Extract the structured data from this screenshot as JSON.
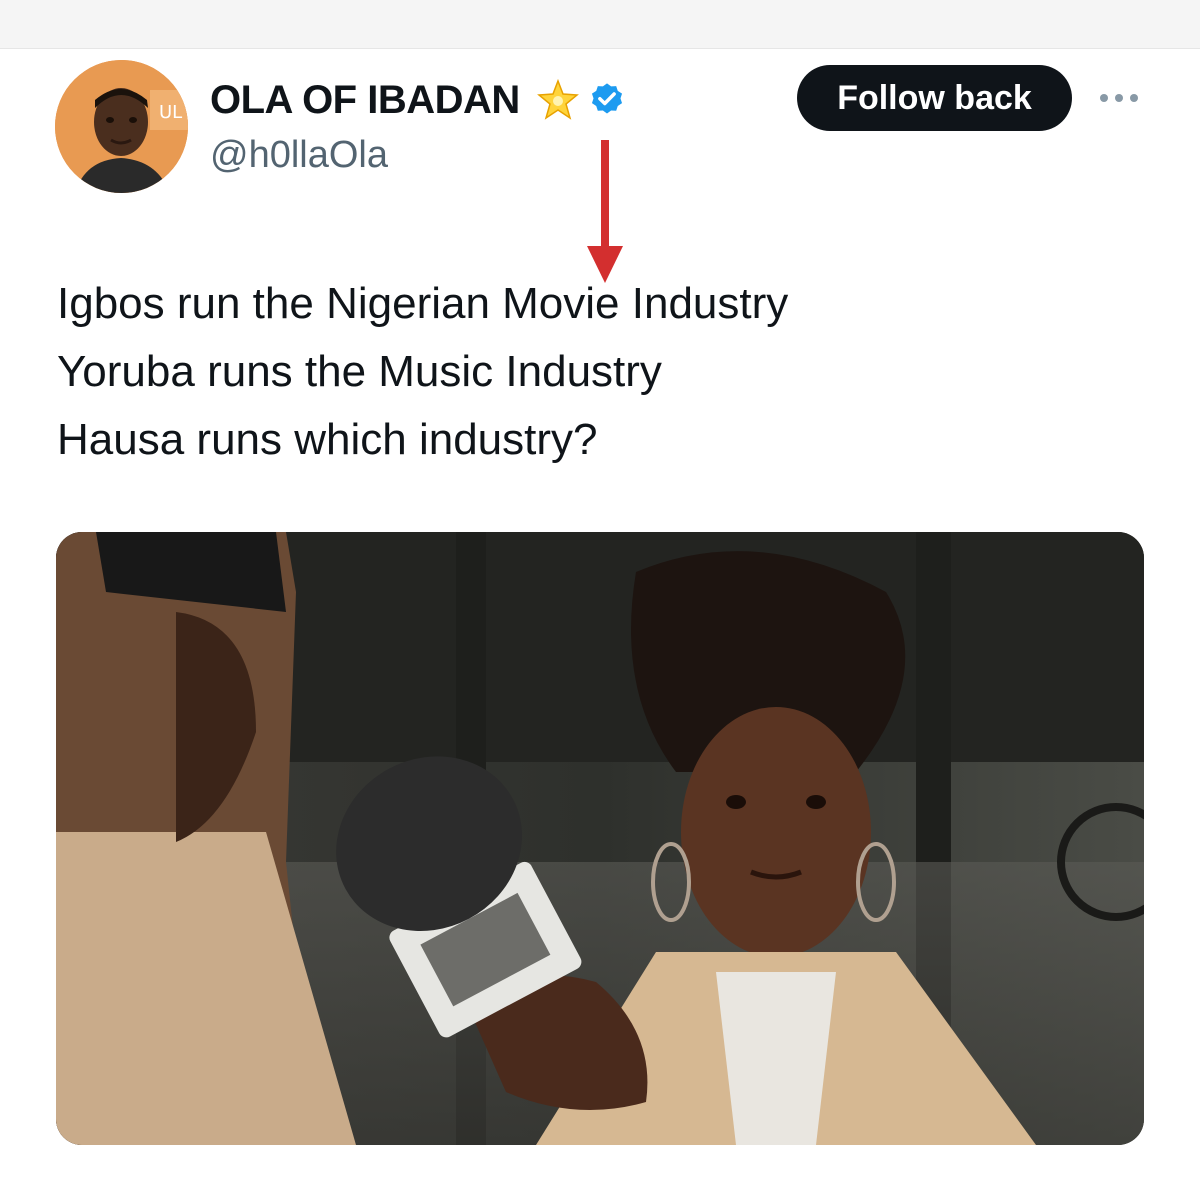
{
  "author": {
    "display_name": "OLA OF IBADAN",
    "handle": "@h0llaOla",
    "name_emoji_icon": "glowing-star-icon",
    "verified_icon": "verified-badge-icon",
    "verified_color": "#1d9bf0"
  },
  "actions": {
    "follow_label": "Follow back",
    "more_icon": "more-options-icon"
  },
  "tweet": {
    "lines": [
      "Igbos run the Nigerian Movie Industry",
      "Yoruba runs the Music Industry",
      "Hausa runs which industry?"
    ]
  },
  "annotation": {
    "icon": "down-arrow-icon",
    "color": "#d32f2f"
  },
  "media": {
    "icon": "photo-interview-microphone"
  },
  "colors": {
    "text": "#0f1419",
    "secondary": "#536471",
    "button_bg": "#0f1419",
    "button_text": "#ffffff"
  }
}
